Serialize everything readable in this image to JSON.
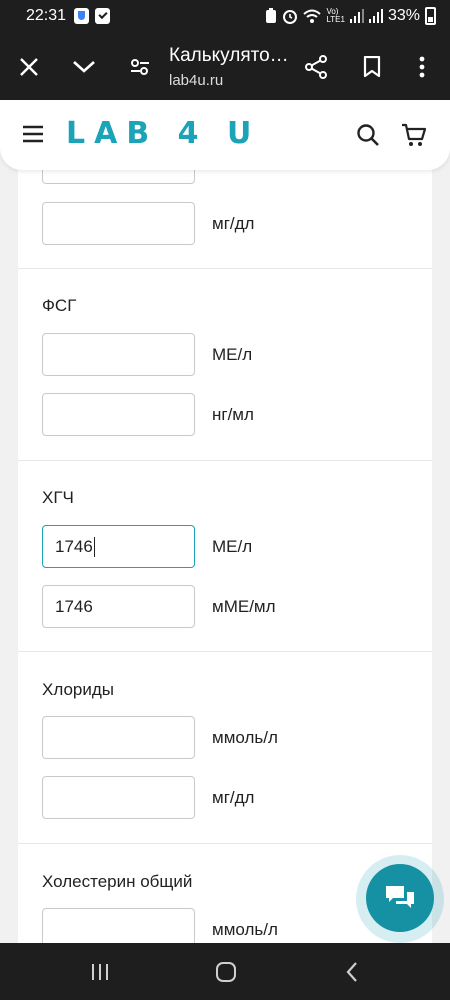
{
  "status": {
    "time": "22:31",
    "battery": "33%",
    "volte": "Vo)",
    "lte": "LTE1"
  },
  "browser": {
    "title": "Калькулято…",
    "url": "lab4u.ru"
  },
  "site": {
    "logo": "LAB 4 U"
  },
  "sections": {
    "partial": {
      "unit": "мг/дл"
    },
    "fsg": {
      "title": "ФСГ",
      "unit1": "МЕ/л",
      "unit2": "нг/мл"
    },
    "hcg": {
      "title": "ХГЧ",
      "value1": "1746",
      "unit1": "МЕ/л",
      "value2": "1746",
      "unit2": "мМЕ/мл"
    },
    "chlorides": {
      "title": "Хлориды",
      "unit1": "ммоль/л",
      "unit2": "мг/дл"
    },
    "cholesterol": {
      "title": "Холестерин общий",
      "unit1": "ммоль/л"
    }
  },
  "icons": {
    "close": "close-icon",
    "collapse": "chevron-down-icon",
    "site_settings": "tune-icon",
    "share": "share-icon",
    "bookmark": "bookmark-icon",
    "more": "more-vert-icon",
    "menu": "hamburger-icon",
    "search": "search-icon",
    "cart": "cart-icon",
    "chat": "chat-icon"
  },
  "colors": {
    "brand": "#1ba3b7",
    "fab": "#1691a3"
  }
}
